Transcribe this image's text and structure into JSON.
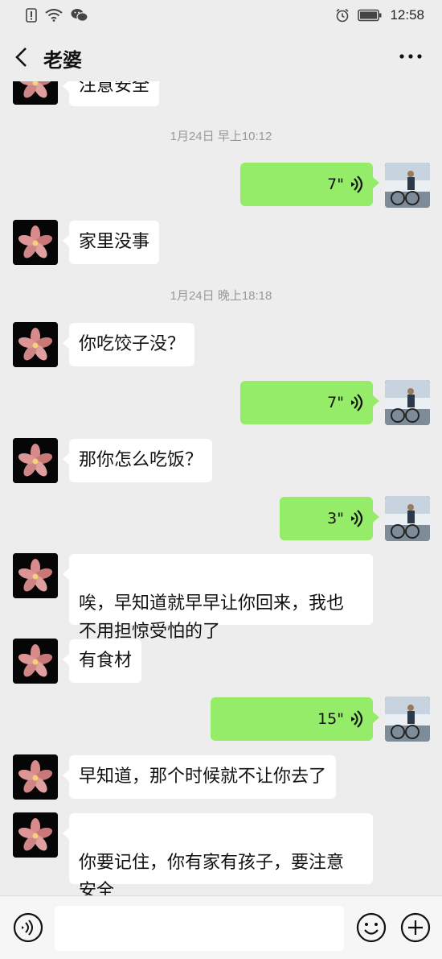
{
  "status_bar": {
    "time": "12:58",
    "icons": [
      "alert-icon",
      "wifi-icon",
      "wechat-icon",
      "alarm-icon",
      "battery-icon"
    ]
  },
  "nav": {
    "title": "老婆"
  },
  "messages": [
    {
      "side": "left",
      "type": "text",
      "text": "注意安全"
    },
    {
      "type": "time",
      "text": "1月24日 早上10:12"
    },
    {
      "side": "right",
      "type": "voice",
      "duration": "7\""
    },
    {
      "side": "left",
      "type": "text",
      "text": "家里没事"
    },
    {
      "type": "time",
      "text": "1月24日 晚上18:18"
    },
    {
      "side": "left",
      "type": "text",
      "text": "你吃饺子没？"
    },
    {
      "side": "right",
      "type": "voice",
      "duration": "7\""
    },
    {
      "side": "left",
      "type": "text",
      "text": "那你怎么吃饭？"
    },
    {
      "side": "right",
      "type": "voice",
      "duration": "3\""
    },
    {
      "side": "left",
      "type": "text",
      "text": "唉，早知道就早早让你回来，我也\n不用担惊受怕的了"
    },
    {
      "side": "left",
      "type": "text",
      "text": "有食材"
    },
    {
      "side": "right",
      "type": "voice",
      "duration": "15\""
    },
    {
      "side": "left",
      "type": "text",
      "text": "早知道，那个时候就不让你去了"
    },
    {
      "side": "left",
      "type": "text",
      "text": "你要记住，你有家有孩子，要注意\n安全"
    }
  ],
  "input": {
    "value": "",
    "placeholder": ""
  },
  "colors": {
    "background": "#ededed",
    "bubble_right": "#95ec69",
    "bubble_left": "#ffffff"
  }
}
